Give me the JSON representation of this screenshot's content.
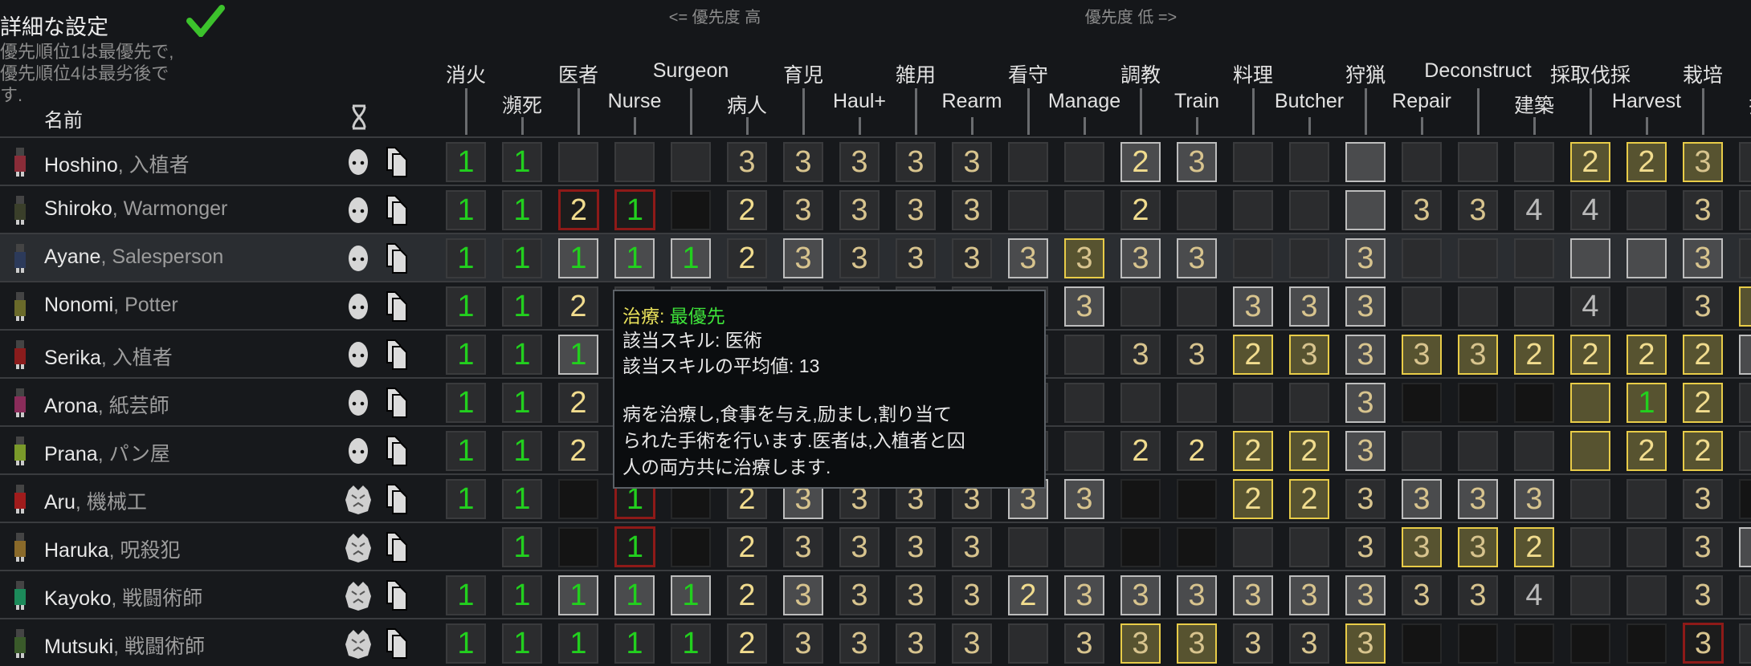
{
  "header": {
    "title": "詳細な設定",
    "hint_lines": [
      "優先順位1は最優先で,",
      "優先順位4は最劣後で",
      "す."
    ],
    "name_column": "名前",
    "priority_high": "<= 優先度 高",
    "priority_low": "優先度 低 =>"
  },
  "icons": {
    "confirm": "checkmark-icon",
    "sort": "dna-icon",
    "face": "mask-face-icon",
    "mech": "mechanoid-head-icon",
    "copy": "copy-document-icon"
  },
  "colors": {
    "priority_1": "#22d01e",
    "priority_2": "#f1dc8e",
    "priority_3": "#d8c48e",
    "priority_4": "#b9b9b9",
    "forced_border": "#8e1a18",
    "high_skill_border": "#e8cc48"
  },
  "work_types": [
    "消火",
    "瀕死",
    "医者",
    "Nurse",
    "Surgeon",
    "病人",
    "育児",
    "Haul+",
    "雑用",
    "Rearm",
    "看守",
    "Manage",
    "調教",
    "Train",
    "料理",
    "Butcher",
    "狩猟",
    "Repair",
    "Deconstruct",
    "建築",
    "採取伐採",
    "Harvest",
    "栽培",
    "採"
  ],
  "pawns": [
    {
      "name": "Hoshino",
      "title": "入植者",
      "icon": "face",
      "selected": false,
      "avatar": "#8a2c38",
      "cells": [
        "1",
        "1",
        "",
        "",
        "",
        "3",
        "3",
        "3",
        "3",
        "3",
        "",
        "",
        "2",
        "3",
        "",
        "",
        "",
        "",
        "",
        "",
        "2",
        "2",
        "3",
        ""
      ],
      "styles": "nnnnnnnnnnnnwwnnwnnnyyyn"
    },
    {
      "name": "Shiroko",
      "title": "Warmonger",
      "icon": "face",
      "selected": false,
      "avatar": "#3a3f2a",
      "cells": [
        "1",
        "1",
        "2",
        "1",
        "",
        "2",
        "3",
        "3",
        "3",
        "3",
        "",
        "",
        "2",
        "",
        "",
        "",
        "",
        "3",
        "3",
        "4",
        "4",
        "",
        "3",
        ""
      ],
      "styles": "nnrrdnnnnnnnnnnnwnnnnnnn"
    },
    {
      "name": "Ayane",
      "title": "Salesperson",
      "icon": "face",
      "selected": true,
      "avatar": "#2c3a5a",
      "cells": [
        "1",
        "1",
        "1",
        "1",
        "1",
        "2",
        "3",
        "3",
        "3",
        "3",
        "3",
        "3",
        "3",
        "3",
        "",
        "",
        "3",
        "",
        "",
        "",
        "",
        "",
        "3",
        ""
      ],
      "styles": "nnwwwnwnnnwywwnnwnnnwwwn"
    },
    {
      "name": "Nonomi",
      "title": "Potter",
      "icon": "face",
      "selected": false,
      "avatar": "#6a6a2a",
      "cells": [
        "1",
        "1",
        "2",
        "",
        "",
        "",
        "",
        "",
        "",
        "",
        "",
        "3",
        "",
        "",
        "3",
        "3",
        "3",
        "",
        "",
        "",
        "4",
        "",
        "3",
        ""
      ],
      "styles": "nnnnnnnnnnnwnnwwwnnnnnny"
    },
    {
      "name": "Serika",
      "title": "入植者",
      "icon": "face",
      "selected": false,
      "avatar": "#8a1c1c",
      "cells": [
        "1",
        "1",
        "1",
        "",
        "",
        "",
        "",
        "",
        "",
        "",
        "",
        "",
        "3",
        "3",
        "2",
        "3",
        "3",
        "3",
        "3",
        "2",
        "2",
        "2",
        "2",
        ""
      ],
      "styles": "nnwnnnnnnnnnnnyywyyyyyyw"
    },
    {
      "name": "Arona",
      "title": "紙芸師",
      "icon": "face",
      "selected": false,
      "avatar": "#8a2c5a",
      "cells": [
        "1",
        "1",
        "2",
        "",
        "",
        "",
        "",
        "",
        "",
        "",
        "",
        "",
        "",
        "",
        "",
        "",
        "3",
        "",
        "",
        "",
        "",
        "1",
        "2",
        ""
      ],
      "styles": "nnnnnnnnnnnnnnnnwdddyyyn"
    },
    {
      "name": "Prana",
      "title": "パン屋",
      "icon": "face",
      "selected": false,
      "avatar": "#7a9a2a",
      "cells": [
        "1",
        "1",
        "2",
        "",
        "",
        "",
        "",
        "",
        "",
        "",
        "",
        "",
        "2",
        "2",
        "2",
        "2",
        "3",
        "",
        "",
        "",
        "",
        "2",
        "2",
        ""
      ],
      "styles": "nnnnnnnnnnnnnnyywnnnyyyn"
    },
    {
      "name": "Aru",
      "title": "機械工",
      "icon": "mech",
      "selected": false,
      "avatar": "#a01c1c",
      "cells": [
        "1",
        "1",
        "",
        "1",
        "",
        "2",
        "3",
        "3",
        "3",
        "3",
        "3",
        "3",
        "",
        "",
        "2",
        "2",
        "3",
        "3",
        "3",
        "3",
        "",
        "",
        "3",
        ""
      ],
      "styles": "nndrdnwnnnwwddyynwwwnnnd"
    },
    {
      "name": "Haruka",
      "title": "呪殺犯",
      "icon": "mech",
      "selected": false,
      "avatar": "#8a6a2a",
      "cells": [
        "",
        "1",
        "",
        "1",
        "",
        "2",
        "3",
        "3",
        "3",
        "3",
        "",
        "",
        "",
        "",
        "",
        "",
        "3",
        "3",
        "3",
        "2",
        "",
        "",
        "3",
        ""
      ],
      "styles": "xndrdnnnnnnnddnnnyyynnnw"
    },
    {
      "name": "Kayoko",
      "title": "戦闘術師",
      "icon": "mech",
      "selected": false,
      "avatar": "#1c8a5a",
      "cells": [
        "1",
        "1",
        "1",
        "1",
        "1",
        "2",
        "3",
        "3",
        "3",
        "3",
        "2",
        "3",
        "3",
        "3",
        "3",
        "3",
        "3",
        "3",
        "3",
        "4",
        "",
        "",
        "3",
        ""
      ],
      "styles": "nnwwwnwnnnwwwwwwwnnnnnnn"
    },
    {
      "name": "Mutsuki",
      "title": "戦闘術師",
      "icon": "mech",
      "selected": false,
      "avatar": "#3a5a2a",
      "cells": [
        "1",
        "1",
        "1",
        "1",
        "1",
        "2",
        "3",
        "3",
        "3",
        "3",
        "",
        "3",
        "3",
        "3",
        "3",
        "3",
        "3",
        "",
        "",
        "",
        "",
        "",
        "3",
        ""
      ],
      "styles": "nnnnnnnnnnnnyynnydddddrn"
    }
  ],
  "tooltip": {
    "work_name": "治療: ",
    "priority": "最優先",
    "skill_line": "該当スキル:  医術",
    "avg_line": "該当スキルの平均値:   13",
    "description": [
      "病を治療し,食事を与え,励まし,割り当て",
      "られた手術を行います.医者は,入植者と囚",
      "人の両方共に治療します."
    ]
  }
}
